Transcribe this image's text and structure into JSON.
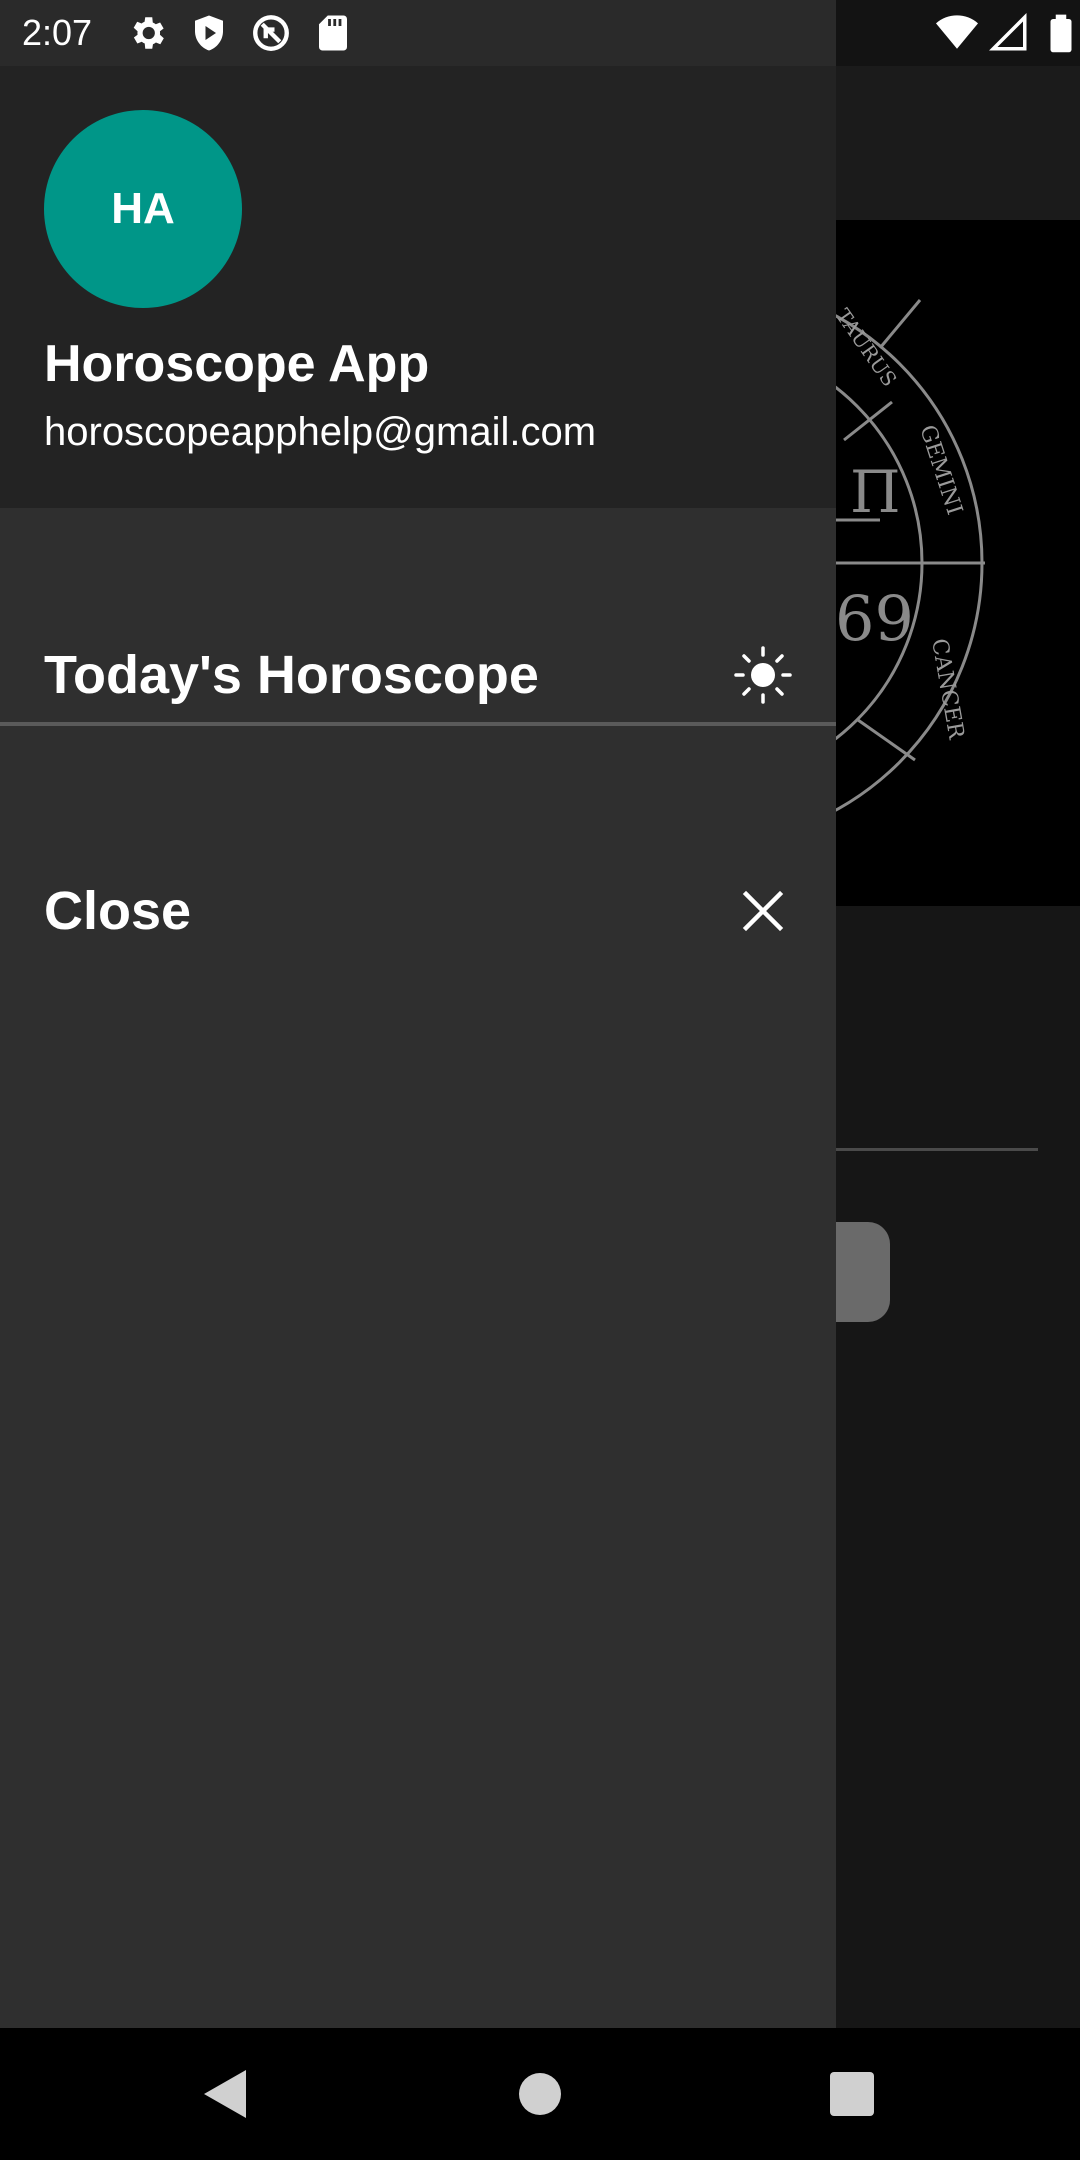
{
  "status_bar": {
    "time": "2:07",
    "left_icons": [
      "settings-icon",
      "shield-icon",
      "data-saver-icon",
      "sd-card-icon"
    ],
    "right_icons": [
      "wifi-icon",
      "signal-icon",
      "battery-icon"
    ]
  },
  "drawer": {
    "header": {
      "avatar_initials": "HA",
      "avatar_color": "#009688",
      "app_name": "Horoscope App",
      "email": "horoscopeapphelp@gmail.com"
    },
    "items": [
      {
        "label": "Today's Horoscope",
        "icon": "sun-icon"
      },
      {
        "label": "Close",
        "icon": "close-icon"
      }
    ]
  },
  "background": {
    "zodiac_labels": [
      "TAURUS",
      "GEMINI",
      "CANCER"
    ]
  },
  "nav_bar": {
    "buttons": [
      "back-icon",
      "home-icon",
      "recents-icon"
    ]
  }
}
